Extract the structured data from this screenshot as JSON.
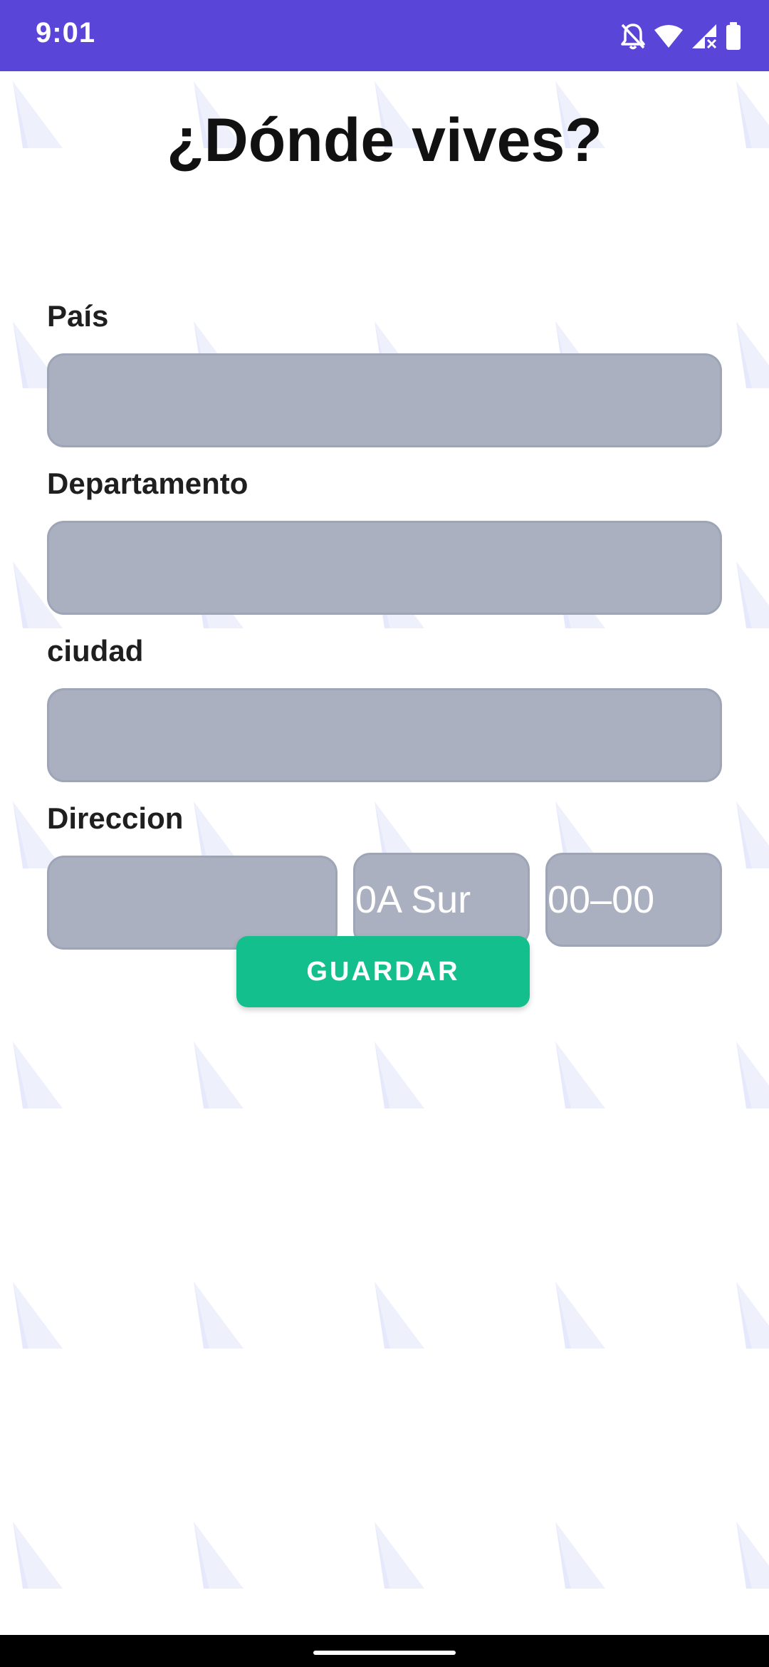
{
  "status_bar": {
    "time": "9:01",
    "icons": [
      "bell-off-icon",
      "wifi-icon",
      "signal-no-data-icon",
      "battery-icon"
    ],
    "background_color": "#5a45d9"
  },
  "page": {
    "title": "¿Dónde vives?"
  },
  "form": {
    "pais": {
      "label": "País",
      "value": ""
    },
    "departamento": {
      "label": "Departamento",
      "value": ""
    },
    "ciudad": {
      "label": "ciudad",
      "value": ""
    },
    "direccion": {
      "label": "Direccion",
      "street": {
        "value": ""
      },
      "number": {
        "placeholder": "0A Sur"
      },
      "plate": {
        "placeholder": "00–00"
      }
    },
    "input_color": "#aab0bf"
  },
  "actions": {
    "save_label": "GUARDAR",
    "save_color": "#13bf8c"
  }
}
